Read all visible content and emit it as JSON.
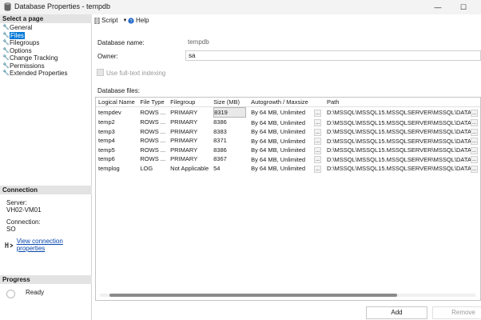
{
  "window": {
    "title": "Database Properties - tempdb"
  },
  "sidebar": {
    "select_page_header": "Select a page",
    "pages": [
      {
        "label": "General"
      },
      {
        "label": "Files"
      },
      {
        "label": "Filegroups"
      },
      {
        "label": "Options"
      },
      {
        "label": "Change Tracking"
      },
      {
        "label": "Permissions"
      },
      {
        "label": "Extended Properties"
      }
    ],
    "selected_page": "Files",
    "connection_header": "Connection",
    "server_label": "Server:",
    "server_value": "VH02-VM01",
    "connection_label": "Connection:",
    "connection_value": "SO",
    "view_connection_link": "View connection properties",
    "progress_header": "Progress",
    "progress_status": "Ready"
  },
  "toolbar": {
    "script_label": "Script",
    "help_label": "Help"
  },
  "main": {
    "database_name_label": "Database name:",
    "database_name_value": "tempdb",
    "owner_label": "Owner:",
    "owner_value": "sa",
    "fulltext_label": "Use full-text indexing",
    "database_files_label": "Database files:",
    "files_table": {
      "columns": [
        "Logical Name",
        "File Type",
        "Filegroup",
        "Size (MB)",
        "Autogrowth / Maxsize",
        "Path"
      ],
      "rows": [
        [
          "tempdev",
          "ROWS ...",
          "PRIMARY",
          "8319",
          "By 64 MB, Unlimited",
          "D:\\MSSQL\\MSSQL15.MSSQLSERVER\\MSSQL\\DATA"
        ],
        [
          "temp2",
          "ROWS ...",
          "PRIMARY",
          "8386",
          "By 64 MB, Unlimited",
          "D:\\MSSQL\\MSSQL15.MSSQLSERVER\\MSSQL\\DATA"
        ],
        [
          "temp3",
          "ROWS ...",
          "PRIMARY",
          "8383",
          "By 64 MB, Unlimited",
          "D:\\MSSQL\\MSSQL15.MSSQLSERVER\\MSSQL\\DATA"
        ],
        [
          "temp4",
          "ROWS ...",
          "PRIMARY",
          "8371",
          "By 64 MB, Unlimited",
          "D:\\MSSQL\\MSSQL15.MSSQLSERVER\\MSSQL\\DATA"
        ],
        [
          "temp5",
          "ROWS ...",
          "PRIMARY",
          "8386",
          "By 64 MB, Unlimited",
          "D:\\MSSQL\\MSSQL15.MSSQLSERVER\\MSSQL\\DATA"
        ],
        [
          "temp6",
          "ROWS ...",
          "PRIMARY",
          "8367",
          "By 64 MB, Unlimited",
          "D:\\MSSQL\\MSSQL15.MSSQLSERVER\\MSSQL\\DATA"
        ],
        [
          "templog",
          "LOG",
          "Not Applicable",
          "54",
          "By 64 MB, Unlimited",
          "D:\\MSSQL\\MSSQL15.MSSQLSERVER\\MSSQL\\DATA"
        ]
      ],
      "ellipsis_label": "..."
    },
    "add_button": "Add",
    "remove_button": "Remove"
  },
  "colors": {
    "accent": "#0078d7",
    "link": "#0645ad",
    "section_header_bg": "#e3e3e3"
  },
  "icons": {
    "title": "database-icon",
    "page": "wrench-icon",
    "script": "script-icon",
    "help": "help-icon",
    "connection": "connection-icon"
  }
}
